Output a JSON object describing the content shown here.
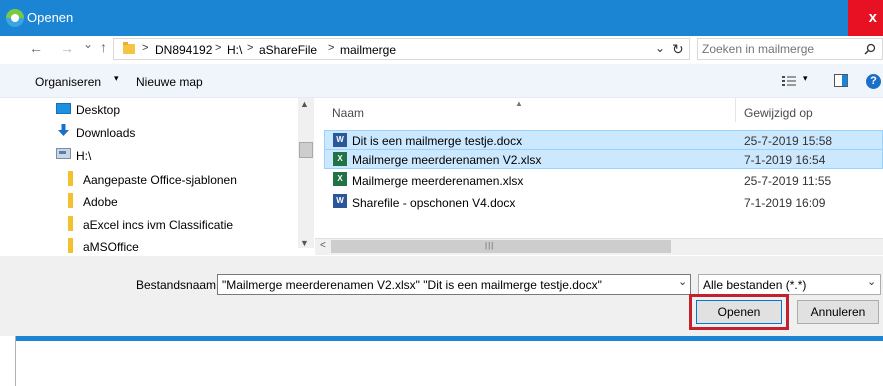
{
  "window": {
    "title": "Openen",
    "close_glyph": "x"
  },
  "nav": {
    "back": "←",
    "forward": "→",
    "dropdown": "⌄",
    "up": "↑",
    "path": [
      "DN894192",
      "H:\\",
      "aShareFile",
      "mailmerge"
    ],
    "separator": ">",
    "refresh": "↻",
    "search_placeholder": "Zoeken in mailmerge"
  },
  "toolbar": {
    "organize": "Organiseren",
    "new_folder": "Nieuwe map"
  },
  "sidebar": {
    "items": [
      {
        "label": "Desktop",
        "icon": "desktop-icon"
      },
      {
        "label": "Downloads",
        "icon": "download-icon"
      },
      {
        "label": "H:\\",
        "icon": "drive-icon"
      },
      {
        "label": "Aangepaste Office-sjablonen",
        "icon": "folder-icon"
      },
      {
        "label": "Adobe",
        "icon": "folder-icon"
      },
      {
        "label": "aExcel incs ivm Classificatie",
        "icon": "folder-icon"
      },
      {
        "label": "aMSOffice",
        "icon": "folder-icon"
      }
    ]
  },
  "file_list": {
    "columns": [
      "Naam",
      "Gewijzigd op"
    ],
    "rows": [
      {
        "name": "Dit is een mailmerge testje.docx",
        "date": "25-7-2019 15:58",
        "type": "word",
        "selected": true
      },
      {
        "name": "Mailmerge meerderenamen V2.xlsx",
        "date": "7-1-2019 16:54",
        "type": "excel",
        "selected": true
      },
      {
        "name": "Mailmerge meerderenamen.xlsx",
        "date": "25-7-2019 11:55",
        "type": "excel",
        "selected": false
      },
      {
        "name": "Sharefile - opschonen V4.docx",
        "date": "7-1-2019 16:09",
        "type": "word",
        "selected": false
      }
    ]
  },
  "bottom": {
    "filename_label": "Bestandsnaam:",
    "filename_value": "\"Mailmerge meerderenamen V2.xlsx\" \"Dit is een mailmerge testje.docx\"",
    "filetype_value": "Alle bestanden (*.*)",
    "open_button": "Openen",
    "cancel_button": "Annuleren"
  },
  "colors": {
    "accent": "#1c85d3",
    "selection": "#cce8ff",
    "highlight": "#c4202d"
  }
}
